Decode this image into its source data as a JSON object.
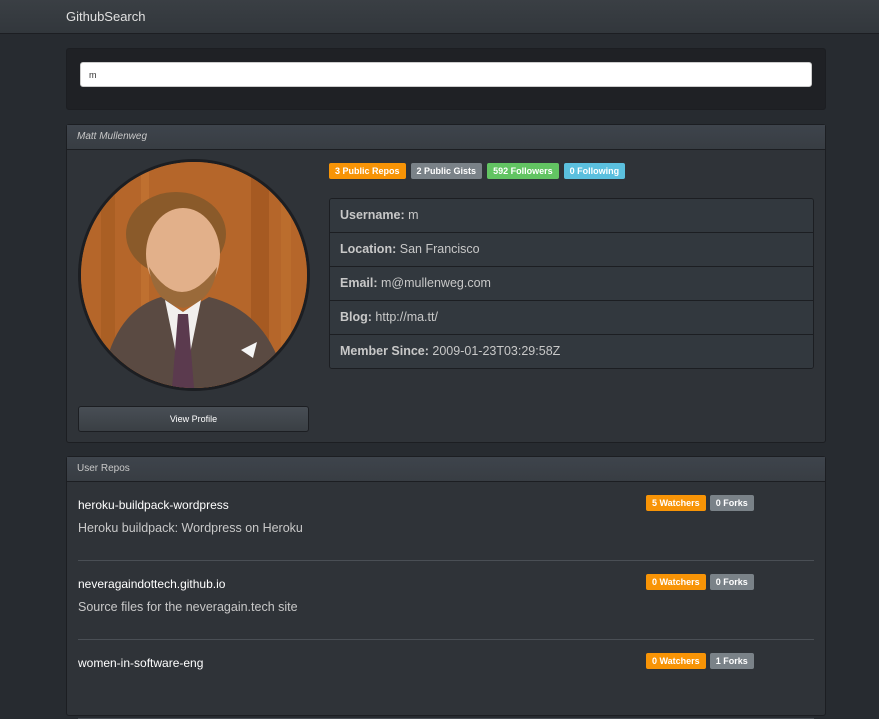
{
  "navbar": {
    "brand": "GithubSearch"
  },
  "search": {
    "value": "m"
  },
  "profile": {
    "name": "Matt Mullenweg",
    "badges": {
      "repos": "3 Public Repos",
      "gists": "2 Public Gists",
      "followers": "592 Followers",
      "following": "0 Following"
    },
    "info": [
      {
        "label": "Username:",
        "value": "m"
      },
      {
        "label": "Location:",
        "value": "San Francisco"
      },
      {
        "label": "Email:",
        "value": "m@mullenweg.com"
      },
      {
        "label": "Blog:",
        "value": "http://ma.tt/"
      },
      {
        "label": "Member Since:",
        "value": "2009-01-23T03:29:58Z"
      }
    ],
    "view_profile_label": "View Profile"
  },
  "repos": {
    "heading": "User Repos",
    "items": [
      {
        "name": "heroku-buildpack-wordpress",
        "description": "Heroku buildpack: Wordpress on Heroku",
        "watchers": "5 Watchers",
        "forks": "0 Forks"
      },
      {
        "name": "neveragaindottech.github.io",
        "description": "Source files for the neveragain.tech site",
        "watchers": "0 Watchers",
        "forks": "0 Forks"
      },
      {
        "name": "women-in-software-eng",
        "description": "",
        "watchers": "0 Watchers",
        "forks": "1 Forks"
      }
    ]
  },
  "colors": {
    "background": "#272b30",
    "badge_orange": "#f89406",
    "badge_gray": "#7a8288",
    "badge_green": "#62c462",
    "badge_blue": "#5bc0de"
  }
}
